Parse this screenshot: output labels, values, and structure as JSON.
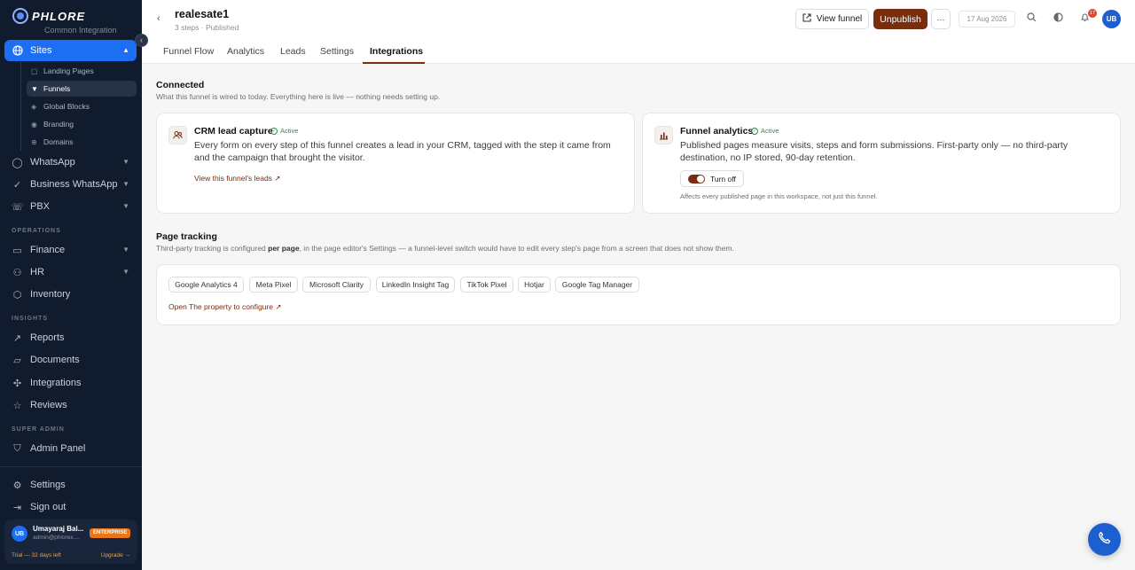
{
  "brand": {
    "name": "PHLORE"
  },
  "sidebar": {
    "cut_item": "Common Integration",
    "items": [
      {
        "label": "Sites",
        "icon": "globe-icon"
      },
      {
        "label": "WhatsApp",
        "icon": "whatsapp-icon"
      },
      {
        "label": "Business WhatsApp",
        "icon": "check-circle-icon"
      },
      {
        "label": "PBX",
        "icon": "phone-icon"
      }
    ],
    "sub_items": [
      {
        "label": "Landing Pages"
      },
      {
        "label": "Funnels"
      },
      {
        "label": "Global Blocks"
      },
      {
        "label": "Branding"
      },
      {
        "label": "Domains"
      }
    ],
    "section_operations": "OPERATIONS",
    "operations": [
      {
        "label": "Finance"
      },
      {
        "label": "HR"
      },
      {
        "label": "Inventory"
      }
    ],
    "section_insights": "INSIGHTS",
    "insights": [
      {
        "label": "Reports"
      },
      {
        "label": "Documents"
      },
      {
        "label": "Integrations"
      },
      {
        "label": "Reviews"
      }
    ],
    "section_super_admin": "SUPER ADMIN",
    "admin": {
      "label": "Admin Panel"
    },
    "settings": "Settings",
    "sign_out": "Sign out",
    "user": {
      "initials": "UB",
      "name": "Umayaraj Bal...",
      "email": "admin@phlorex....",
      "plan": "ENTERPRISE",
      "trial": "Trial — 32 days left",
      "upgrade": "Upgrade →"
    }
  },
  "header": {
    "title": "realesate1",
    "subtitle": "3 steps · Published",
    "view_funnel": "View funnel",
    "unpublish": "Unpublish",
    "more": "···",
    "date": "17 Aug 2026",
    "notifications": "17",
    "avatar": "UB"
  },
  "tabs": [
    "Funnel Flow",
    "Analytics",
    "Leads",
    "Settings",
    "Integrations"
  ],
  "connected": {
    "title": "Connected",
    "desc": "What this funnel is wired to today. Everything here is live — nothing needs setting up."
  },
  "crm": {
    "title": "CRM lead capture",
    "status": "Active",
    "body": "Every form on every step of this funnel creates a lead in your CRM, tagged with the step it came from and the campaign that brought the visitor.",
    "link": "View this funnel's leads ↗"
  },
  "analytics": {
    "title": "Funnel analytics",
    "status": "Active",
    "body": "Published pages measure visits, steps and form submissions. First-party only — no third-party destination, no IP stored, 90-day retention.",
    "toggle": "Turn off",
    "note": "Affects every published page in this workspace, not just this funnel."
  },
  "tracking": {
    "title": "Page tracking",
    "desc_pre": "Third-party tracking is configured ",
    "desc_bold": "per page",
    "desc_post": ", in the page editor's Settings — a funnel-level switch would have to edit every step's page from a screen that does not show them.",
    "pills": [
      "Google Analytics 4",
      "Meta Pixel",
      "Microsoft Clarity",
      "LinkedIn Insight Tag",
      "TikTok Pixel",
      "Hotjar",
      "Google Tag Manager"
    ],
    "link": "Open The property to configure ↗"
  },
  "colors": {
    "accent": "#7a2d0d",
    "sidebar_bg": "#101b2d",
    "active_nav": "#1c6ef2",
    "success": "#2f8a4a"
  }
}
